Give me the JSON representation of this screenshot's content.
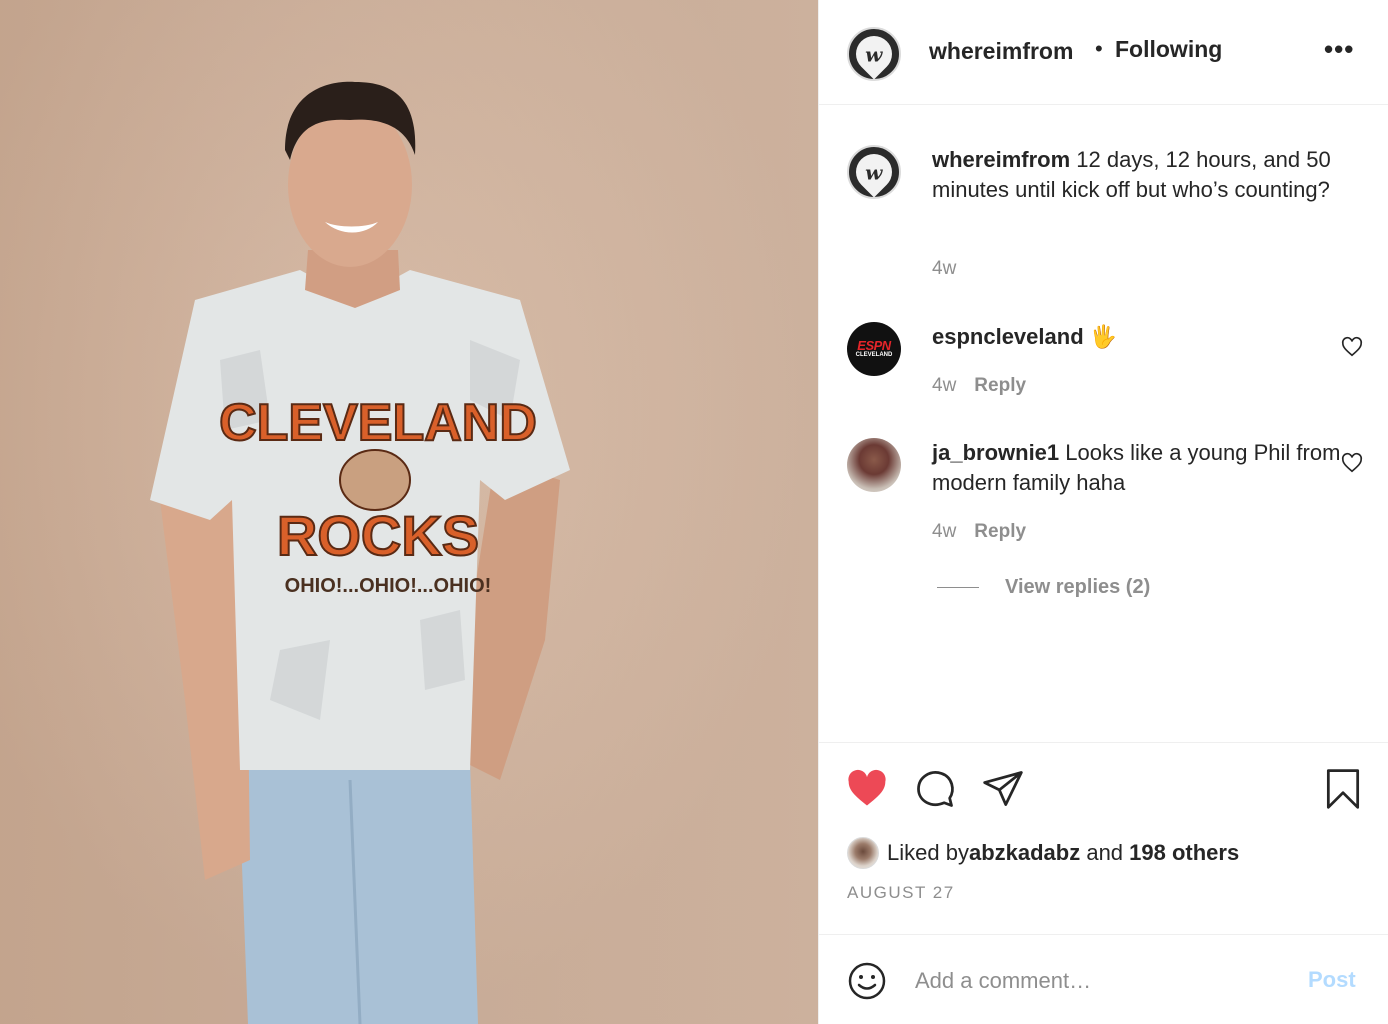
{
  "post": {
    "username": "whereimfrom",
    "follow_separator": "•",
    "follow_status": "Following",
    "more_label": "•••",
    "avatar_letter": "w"
  },
  "photo": {
    "shirt_text_top": "CLEVELAND",
    "shirt_text_mid": "ROCKS",
    "shirt_text_bottom": "OHIO!...OHIO!...OHIO!"
  },
  "caption": {
    "username": "whereimfrom",
    "text": " 12 days, 12 hours, and 50 minutes until kick off but who’s counting?",
    "time": "4w"
  },
  "comments": [
    {
      "username": "espncleveland",
      "text": " 🖐",
      "time": "4w",
      "reply_label": "Reply",
      "avatar_line1": "ESPN",
      "avatar_line2": "CLEVELAND"
    },
    {
      "username": "ja_brownie1",
      "text": " Looks like a young Phil from modern family haha",
      "time": "4w",
      "reply_label": "Reply"
    }
  ],
  "view_replies": "View replies (2)",
  "likes": {
    "prefix": "Liked by ",
    "user": "abzkadabz",
    "middle": " and ",
    "others": "198 others"
  },
  "date": "AUGUST 27",
  "add_comment": {
    "placeholder": "Add a comment…",
    "post_label": "Post"
  },
  "colors": {
    "like_red": "#ed4956",
    "post_disabled": "#b3dbff",
    "muted": "#8e8e8e"
  },
  "icons": [
    "heart-filled-icon",
    "comment-icon",
    "share-icon",
    "bookmark-icon",
    "heart-outline-icon",
    "emoji-icon"
  ]
}
